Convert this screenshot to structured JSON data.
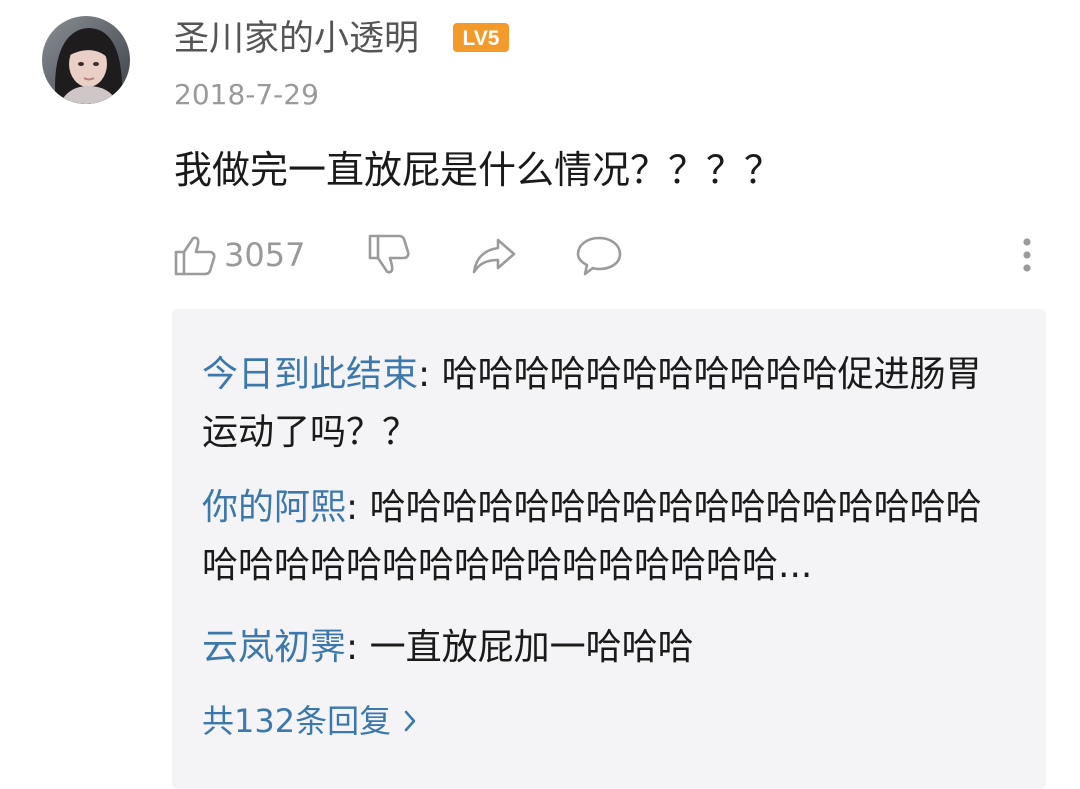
{
  "comment": {
    "username": "圣川家的小透明",
    "level_badge": "LV5",
    "date": "2018-7-29",
    "text": "我做完一直放屁是什么情况？？？？",
    "like_count": "3057"
  },
  "replies": [
    {
      "user": "今日到此结束",
      "separator": ": ",
      "text": "哈哈哈哈哈哈哈哈哈哈哈促进肠胃运动了吗？？"
    },
    {
      "user": "你的阿熙",
      "separator": ": ",
      "text": "哈哈哈哈哈哈哈哈哈哈哈哈哈哈哈哈哈哈哈哈哈哈哈哈哈哈哈哈哈哈哈哈哈..."
    },
    {
      "user": "云岚初霁",
      "separator": ": ",
      "text": "一直放屁加一哈哈哈"
    }
  ],
  "more_replies_label": "共132条回复",
  "colors": {
    "reply_user": "#3d78ad",
    "badge": "#f39a2b",
    "secondary_text": "#999999",
    "reply_box_bg": "#f4f4f6"
  },
  "icons": [
    "avatar",
    "lv5-badge",
    "thumbs-up-icon",
    "thumbs-down-icon",
    "share-icon",
    "comment-icon",
    "more-vertical-icon",
    "chevron-right-icon"
  ]
}
